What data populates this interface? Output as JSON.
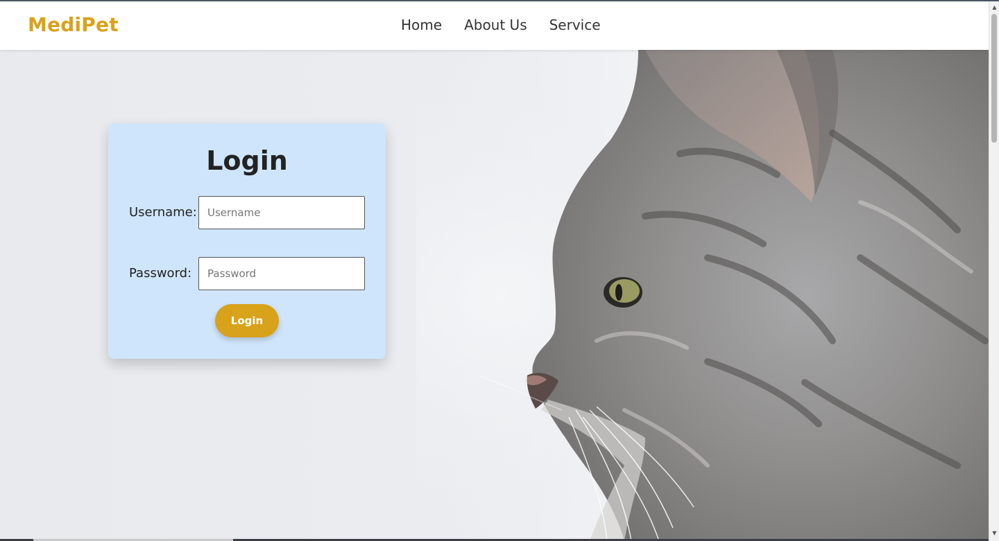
{
  "header": {
    "brand": "MediPet",
    "nav": [
      {
        "label": "Home"
      },
      {
        "label": "About Us"
      },
      {
        "label": "Service"
      }
    ]
  },
  "login": {
    "title": "Login",
    "username_label": "Username:",
    "username_placeholder": "Username",
    "password_label": "Password:",
    "password_placeholder": "Password",
    "submit_label": "Login"
  },
  "colors": {
    "brand": "#d9a21b",
    "card_bg": "#cfe5fb",
    "page_bg": "#e9ebef"
  },
  "icons": {
    "scroll_up": "scroll-up-arrow-icon",
    "scroll_down": "scroll-down-arrow-icon"
  }
}
